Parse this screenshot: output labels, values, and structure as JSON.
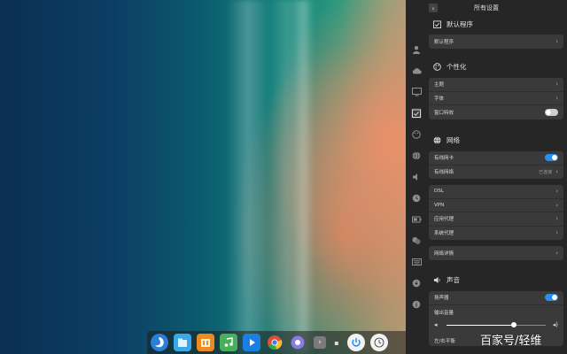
{
  "panel": {
    "title": "所有设置",
    "sections": {
      "default_apps": {
        "title": "默认程序",
        "rows": [
          {
            "label": "默认程序"
          }
        ]
      },
      "personalization": {
        "title": "个性化",
        "rows": [
          {
            "label": "主题"
          },
          {
            "label": "字体"
          },
          {
            "label": "窗口特效"
          }
        ]
      },
      "network": {
        "title": "网络",
        "wired_card": "有线网卡",
        "wired_network": "有线网络",
        "wired_status": "已连接",
        "rows": [
          {
            "label": "DSL"
          },
          {
            "label": "VPN"
          },
          {
            "label": "应用代理"
          },
          {
            "label": "系统代理"
          }
        ],
        "details": "网络详情"
      },
      "sound": {
        "title": "声音",
        "speaker": "扬声器",
        "output_volume": "输出音量",
        "output_volume_value": 0.68,
        "next_row": "左/右平衡"
      }
    },
    "toggles": {
      "window_effects": false,
      "wired_card": true,
      "speaker": true
    },
    "accent_color": "#2a8ff0"
  },
  "dock": {
    "items": [
      {
        "icon": "launcher-icon",
        "color": "#2b7fd6"
      },
      {
        "icon": "file-manager-icon",
        "color": "#3aa7e8"
      },
      {
        "icon": "store-icon",
        "color": "#f08a1e"
      },
      {
        "icon": "music-icon",
        "color": "#49b05a"
      },
      {
        "icon": "video-icon",
        "color": "#1a7fe0"
      },
      {
        "icon": "chrome-icon",
        "color": "#e04b3a"
      },
      {
        "icon": "settings-icon",
        "color": "#7a6bd6"
      },
      {
        "icon": "terminal-icon",
        "color": "#555555"
      },
      {
        "icon": "power-icon",
        "color": "#2a8ff0"
      },
      {
        "icon": "clock-icon",
        "color": "#f2f2f2"
      }
    ]
  },
  "watermark": "百家号/轻维"
}
